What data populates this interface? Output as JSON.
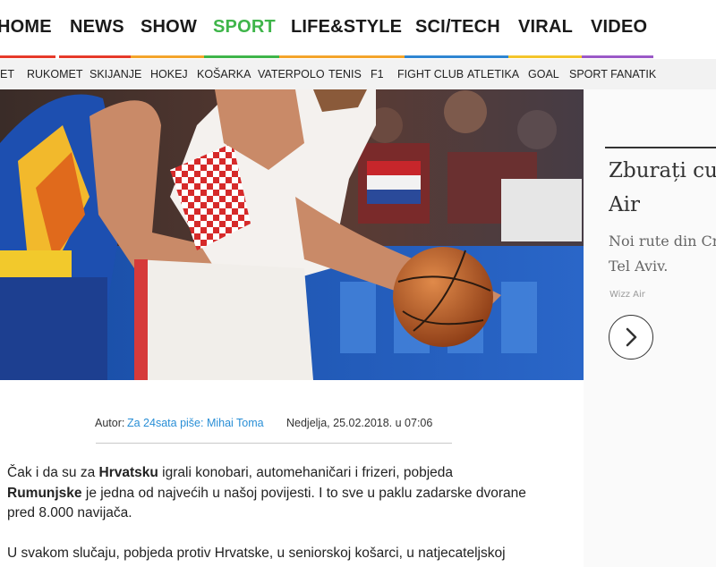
{
  "topnav": {
    "items": [
      "HOME",
      "NEWS",
      "SHOW",
      "SPORT",
      "LIFE&STYLE",
      "SCI/TECH",
      "VIRAL",
      "VIDEO"
    ],
    "active": "SPORT"
  },
  "subnav": {
    "items": [
      "ET",
      "RUKOMET",
      "SKIJANJE",
      "HOKEJ",
      "KOŠARKA",
      "VATERPOLO",
      "TENIS",
      "F1",
      "FIGHT CLUB",
      "ATLETIKA",
      "GOAL",
      "SPORT FANATIK"
    ]
  },
  "colors": {
    "active_nav": "#3fb54a",
    "link": "#2a8fd6",
    "nav_bars": [
      "#e63a2a",
      "#e63a2a",
      "#f4a52b",
      "#3fb54a",
      "#2f86d2",
      "#2f86d2",
      "#f4c52b",
      "#f4c52b",
      "#9b59c7"
    ]
  },
  "ad": {
    "title_line1": "Zburați cu",
    "title_line2": "Air",
    "desc_line1": "Noi rute din Cra",
    "desc_line2": "Tel Aviv.",
    "source": "Wizz Air",
    "arrow_icon": "chevron-right-icon"
  },
  "article": {
    "author_label": "Autor:",
    "author_link": "Za 24sata piše: Mihai Toma",
    "date": "Nedjelja, 25.02.2018. u 07:06",
    "p1_a": "Čak i da su za ",
    "p1_b": "Hrvatsku",
    "p1_c": " igrali konobari, automehaničari i frizeri, pobjeda ",
    "p1_d": "Rumunjske",
    "p1_e": " je jedna od najvećih u našoj povijesti. I to sve u paklu zadarske dvorane pred 8.000 navijača.",
    "p2": "U svakom slučaju, pobjeda protiv Hrvatske, u seniorskoj košarci, u natjecateljskoj"
  }
}
